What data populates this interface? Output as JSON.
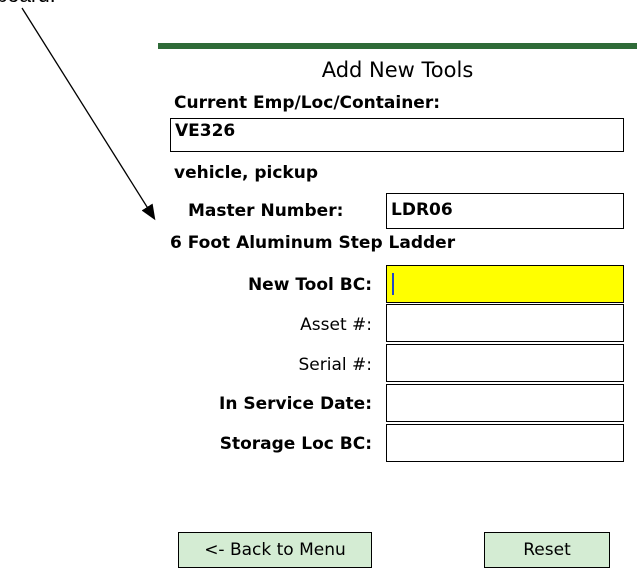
{
  "caption": "board.",
  "form": {
    "title": "Add New Tools",
    "current_label": "Current Emp/Loc/Container:",
    "current_value": "VE326",
    "current_desc": "vehicle, pickup",
    "master_label": "Master Number:",
    "master_value": "LDR06",
    "master_desc": "6 Foot Aluminum Step Ladder",
    "fields": [
      {
        "label": "New Tool BC:",
        "value": "",
        "active": true
      },
      {
        "label": "Asset #:",
        "value": "",
        "active": false
      },
      {
        "label": "Serial #:",
        "value": "",
        "active": false
      },
      {
        "label": "In Service Date:",
        "value": "",
        "active": false
      },
      {
        "label": "Storage Loc BC:",
        "value": "",
        "active": false
      }
    ],
    "back_button": "<- Back to Menu",
    "reset_button": "Reset"
  },
  "colors": {
    "header_bar": "#2f6b38",
    "active_field": "#ffff00",
    "button": "#d4ecd3"
  }
}
